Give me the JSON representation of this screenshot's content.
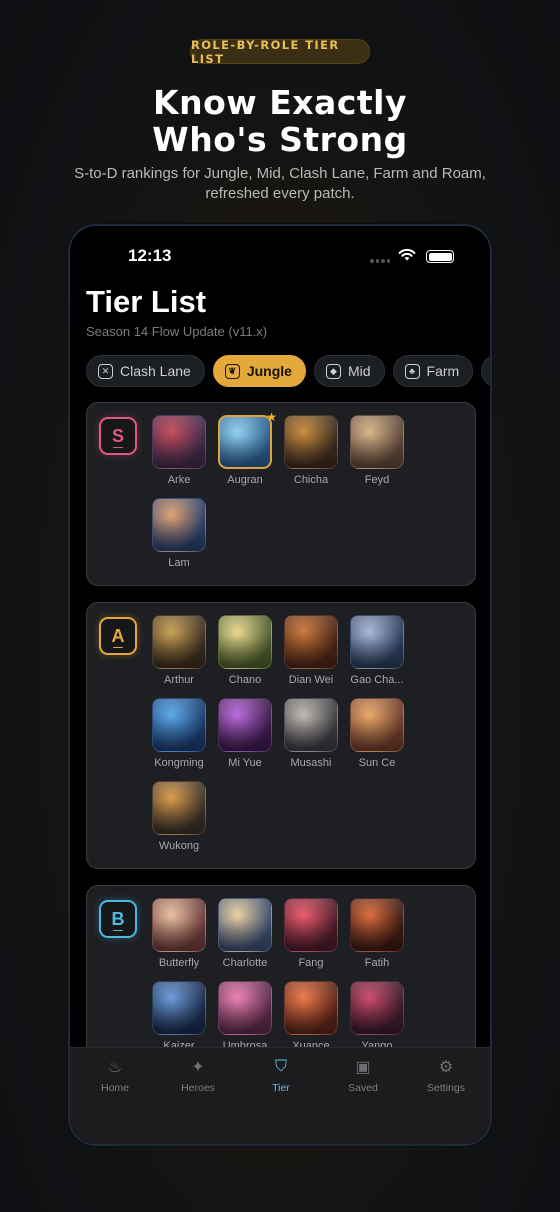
{
  "promo": {
    "badge": "ROLE-BY-ROLE TIER LIST",
    "headline_line1": "Know Exactly",
    "headline_line2": "Who's Strong",
    "subhead": "S-to-D rankings for Jungle, Mid, Clash Lane, Farm and Roam, refreshed every patch."
  },
  "status_bar": {
    "time": "12:13"
  },
  "screen": {
    "title": "Tier List",
    "season": "Season 14 Flow Update (v11.x)"
  },
  "tabs": [
    {
      "label": "Clash Lane",
      "icon": "crossed-swords-icon",
      "glyph": "✕",
      "active": false
    },
    {
      "label": "Jungle",
      "icon": "leaf-icon",
      "glyph": "❦",
      "active": true
    },
    {
      "label": "Mid",
      "icon": "drop-icon",
      "glyph": "◆",
      "active": false
    },
    {
      "label": "Farm",
      "icon": "sprout-icon",
      "glyph": "♣",
      "active": false
    }
  ],
  "tiers": [
    {
      "label": "S",
      "color": "#e2577f",
      "heroes": [
        {
          "name": "Arke",
          "c1": "#3d2a4a",
          "c2": "#c34a5a"
        },
        {
          "name": "Augran",
          "c1": "#2a5c8a",
          "c2": "#8fd0ef",
          "featured": true
        },
        {
          "name": "Chicha",
          "c1": "#3a2a1e",
          "c2": "#c88c3e"
        },
        {
          "name": "Feyd",
          "c1": "#5a4636",
          "c2": "#d9b48a"
        },
        {
          "name": "Lam",
          "c1": "#2a3f6a",
          "c2": "#e0a070"
        }
      ]
    },
    {
      "label": "A",
      "color": "#e3a93a",
      "heroes": [
        {
          "name": "Arthur",
          "c1": "#3a2e1e",
          "c2": "#c9a055"
        },
        {
          "name": "Chano",
          "c1": "#4a5a2a",
          "c2": "#e8d890"
        },
        {
          "name": "Dian Wei",
          "c1": "#4a2418",
          "c2": "#c8783a"
        },
        {
          "name": "Gao Cha...",
          "c1": "#2a3a5a",
          "c2": "#a8b8d8"
        },
        {
          "name": "Kongming",
          "c1": "#1a3a6a",
          "c2": "#5aa8e8"
        },
        {
          "name": "Mi Yue",
          "c1": "#3a1a4a",
          "c2": "#b86ad8"
        },
        {
          "name": "Musashi",
          "c1": "#3a3a40",
          "c2": "#c0b8b0"
        },
        {
          "name": "Sun Ce",
          "c1": "#6a3a2a",
          "c2": "#e8a868"
        },
        {
          "name": "Wukong",
          "c1": "#3a3028",
          "c2": "#d89a4a"
        }
      ]
    },
    {
      "label": "B",
      "color": "#4fb8e0",
      "heroes": [
        {
          "name": "Butterfly",
          "c1": "#6a3a3a",
          "c2": "#e8c0a0"
        },
        {
          "name": "Charlotte",
          "c1": "#3a4a6a",
          "c2": "#e8d0a0"
        },
        {
          "name": "Fang",
          "c1": "#4a1a2a",
          "c2": "#e85a6a"
        },
        {
          "name": "Fatih",
          "c1": "#3a1a14",
          "c2": "#d86a3a"
        },
        {
          "name": "Kaizer",
          "c1": "#1a2a4a",
          "c2": "#6a9ad8"
        },
        {
          "name": "Umbrosa",
          "c1": "#5a2a4a",
          "c2": "#e880b0"
        },
        {
          "name": "Xuance",
          "c1": "#5a2418",
          "c2": "#e87848"
        },
        {
          "name": "Yango",
          "c1": "#3a1a2a",
          "c2": "#c84a6a"
        }
      ]
    }
  ],
  "nav": [
    {
      "label": "Home",
      "icon": "flame-icon",
      "glyph": "♨",
      "active": false
    },
    {
      "label": "Heroes",
      "icon": "hero-icon",
      "glyph": "✦",
      "active": false
    },
    {
      "label": "Tier",
      "icon": "tier-shield-icon",
      "glyph": "⛉",
      "active": true
    },
    {
      "label": "Saved",
      "icon": "saved-chest-icon",
      "glyph": "▣",
      "active": false
    },
    {
      "label": "Settings",
      "icon": "gear-icon",
      "glyph": "⚙",
      "active": false
    }
  ]
}
